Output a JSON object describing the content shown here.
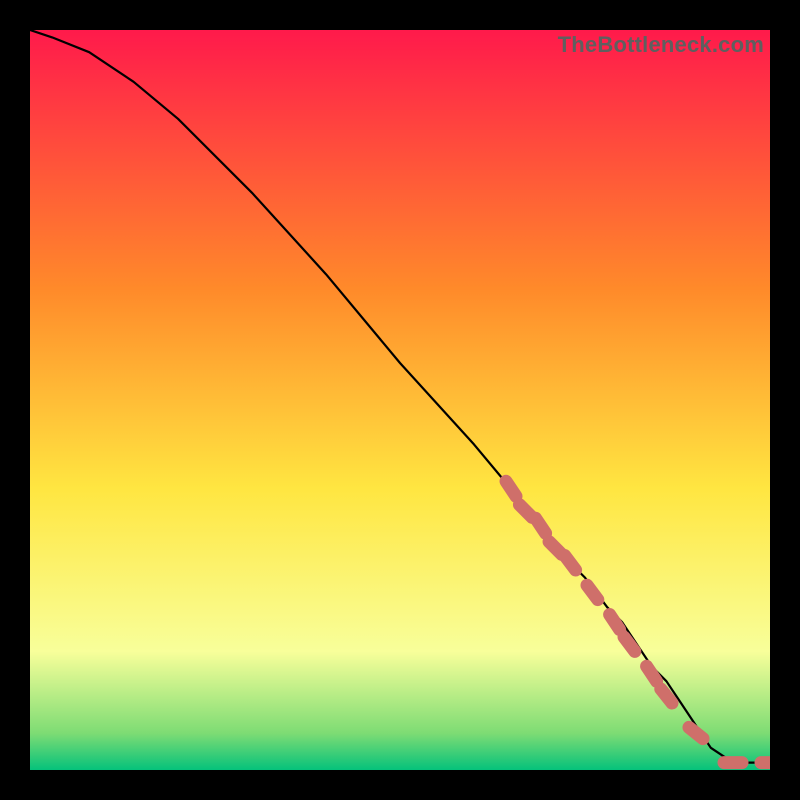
{
  "watermark": "TheBottleneck.com",
  "chart_data": {
    "type": "line",
    "title": "",
    "xlabel": "",
    "ylabel": "",
    "xlim": [
      0,
      100
    ],
    "ylim": [
      0,
      100
    ],
    "grid": false,
    "legend": false,
    "gradient_colors": {
      "top": "#ff1a4b",
      "mid1": "#ff8a2a",
      "mid2": "#ffe641",
      "mid3": "#f8ff9a",
      "mid4": "#7edc74",
      "bottom": "#05c27b"
    },
    "series": [
      {
        "name": "bottleneck-curve",
        "type": "line",
        "color": "#000000",
        "x": [
          0,
          3,
          8,
          14,
          20,
          30,
          40,
          50,
          60,
          65,
          70,
          73,
          75,
          78,
          80,
          82,
          84,
          86,
          88,
          90,
          92,
          95,
          98,
          100
        ],
        "y": [
          100,
          99,
          97,
          93,
          88,
          78,
          67,
          55,
          44,
          38,
          32,
          28,
          26,
          22,
          20,
          17,
          14,
          12,
          9,
          6,
          3,
          1,
          1,
          1
        ]
      },
      {
        "name": "highlighted-points",
        "type": "scatter",
        "color": "#cf6f6a",
        "x": [
          65,
          67,
          69,
          71,
          73,
          76,
          79,
          81,
          84,
          86,
          90,
          95,
          100
        ],
        "y": [
          38,
          35,
          33,
          30,
          28,
          24,
          20,
          17,
          13,
          10,
          5,
          1,
          1
        ]
      }
    ]
  }
}
